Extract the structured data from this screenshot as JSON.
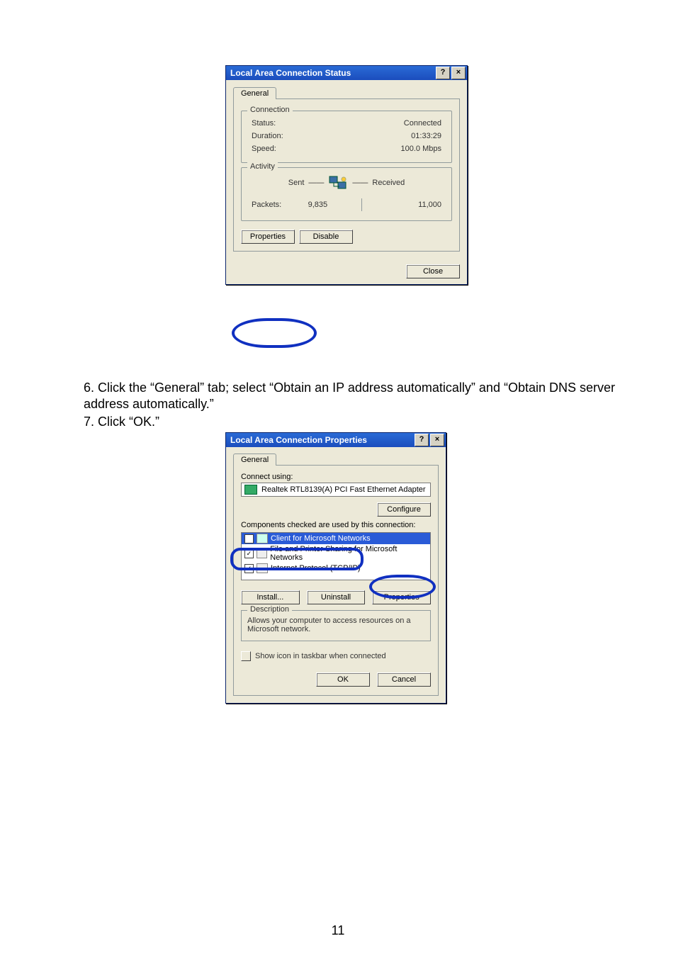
{
  "dialog1": {
    "title": "Local Area Connection Status",
    "tab": "General",
    "group_connection": "Connection",
    "status_label": "Status:",
    "status_value": "Connected",
    "duration_label": "Duration:",
    "duration_value": "01:33:29",
    "speed_label": "Speed:",
    "speed_value": "100.0 Mbps",
    "group_activity": "Activity",
    "sent_label": "Sent",
    "received_label": "Received",
    "packets_label": "Packets:",
    "sent_value": "9,835",
    "received_value": "11,000",
    "btn_properties": "Properties",
    "btn_disable": "Disable",
    "btn_close": "Close",
    "help_glyph": "?",
    "close_glyph": "×"
  },
  "instructions": {
    "step6": "6. Click the “General” tab; select “Obtain an IP address automatically” and “Obtain DNS server address automatically.”",
    "step7": "7. Click “OK.”"
  },
  "dialog2": {
    "title": "Local Area Connection Properties",
    "tab": "General",
    "connect_using": "Connect using:",
    "adapter": "Realtek RTL8139(A) PCI Fast Ethernet Adapter",
    "btn_configure": "Configure",
    "components_label": "Components checked are used by this connection:",
    "item_client": "Client for Microsoft Networks",
    "item_fileshare": "File and Printer Sharing for Microsoft Networks",
    "item_tcpip": "Internet Protocol (TCP/IP)",
    "btn_install": "Install...",
    "btn_uninstall": "Uninstall",
    "btn_properties": "Properties",
    "desc_title": "Description",
    "desc_text": "Allows your computer to access resources on a Microsoft network.",
    "show_icon": "Show icon in taskbar when connected",
    "btn_ok": "OK",
    "btn_cancel": "Cancel",
    "help_glyph": "?",
    "close_glyph": "×",
    "check_glyph": "✓"
  },
  "page_number": "11"
}
